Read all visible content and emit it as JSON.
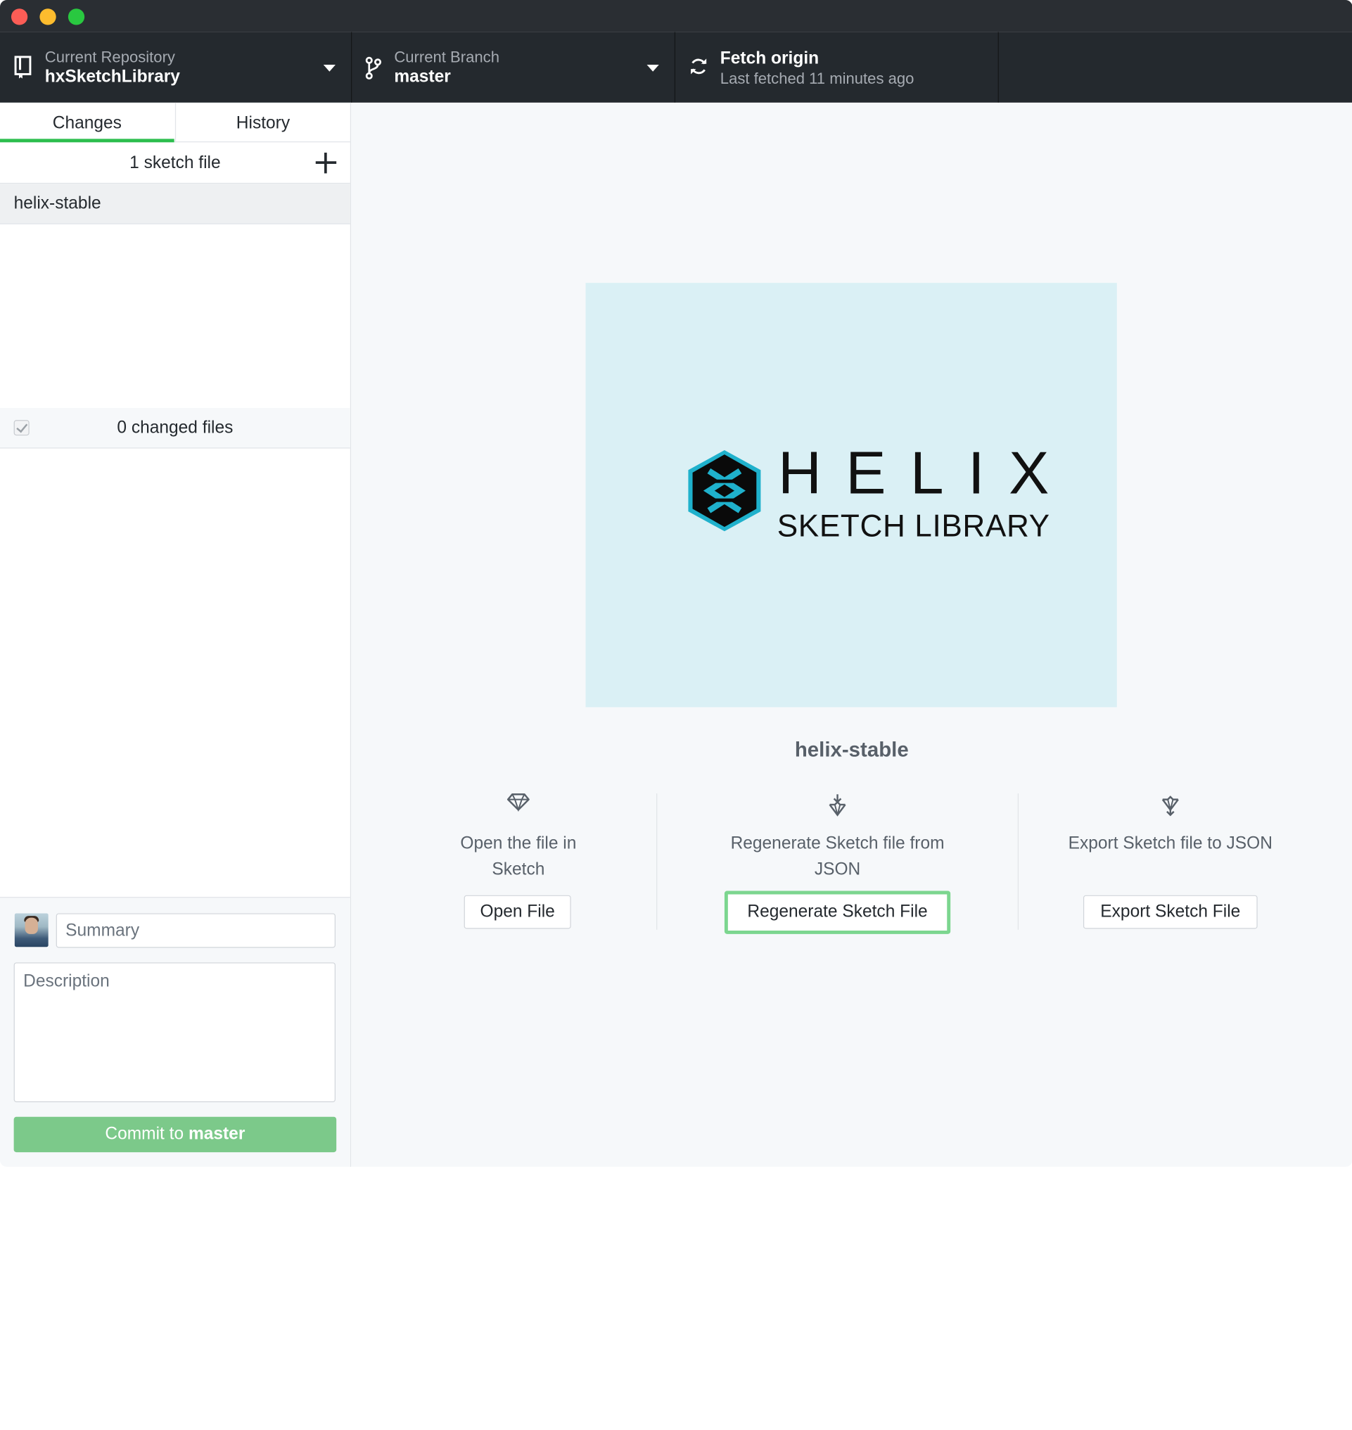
{
  "toolbar": {
    "repository": {
      "label": "Current Repository",
      "value": "hxSketchLibrary"
    },
    "branch": {
      "label": "Current Branch",
      "value": "master"
    },
    "fetch": {
      "title": "Fetch origin",
      "subtitle": "Last fetched 11 minutes ago"
    }
  },
  "sidebar": {
    "tabs": [
      {
        "label": "Changes",
        "active": true
      },
      {
        "label": "History",
        "active": false
      }
    ],
    "sketch_header": "1 sketch file",
    "files": [
      {
        "name": "helix-stable"
      }
    ],
    "changed_header": "0 changed files",
    "commit": {
      "summary_placeholder": "Summary",
      "description_placeholder": "Description",
      "button_prefix": "Commit to ",
      "button_branch": "master"
    }
  },
  "main": {
    "logo": {
      "word": "HELIX",
      "sub": "SKETCH LIBRARY"
    },
    "document_name": "helix-stable",
    "actions": [
      {
        "description": "Open the file in Sketch",
        "button": "Open File",
        "icon": "sketch-diamond-icon"
      },
      {
        "description": "Regenerate Sketch file from JSON",
        "button": "Regenerate Sketch File",
        "icon": "regenerate-icon"
      },
      {
        "description": "Export Sketch file to JSON",
        "button": "Export Sketch File",
        "icon": "export-icon"
      }
    ]
  },
  "colors": {
    "toolbar_bg": "#24292e",
    "accent_green": "#2cbe4e",
    "commit_button": "#7cc98a",
    "preview_bg": "#daf0f5"
  }
}
